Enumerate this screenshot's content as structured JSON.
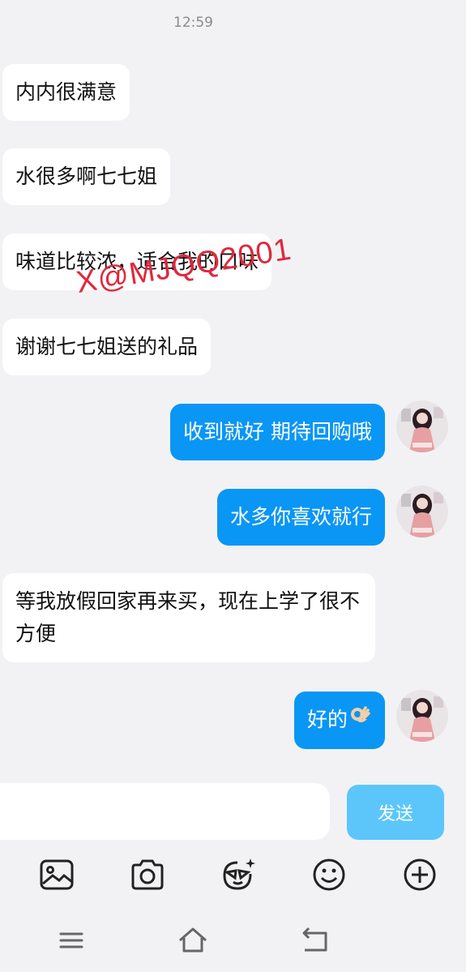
{
  "status": {
    "time": "12:59"
  },
  "messages": [
    {
      "side": "left",
      "text": "内内很满意"
    },
    {
      "side": "left",
      "text": "水很多啊七七姐"
    },
    {
      "side": "left",
      "text": "味道比较浓，适合我的口味"
    },
    {
      "side": "left",
      "text": "谢谢七七姐送的礼品"
    },
    {
      "side": "right",
      "text": "收到就好 期待回购哦"
    },
    {
      "side": "right",
      "text": "水多你喜欢就行"
    },
    {
      "side": "left",
      "text": "等我放假回家再来买，现在上学了很不方便"
    },
    {
      "side": "right",
      "text": "好的",
      "emoji": "ok-hand"
    }
  ],
  "watermark": "X@MJQQ2001",
  "composer": {
    "input_value": "",
    "send_label": "发送",
    "send_color": "#5cc6fb"
  },
  "toolbar": [
    "image-icon",
    "camera-icon",
    "sticker-icon",
    "emoji-icon",
    "add-icon"
  ],
  "navbar": [
    "menu-icon",
    "home-icon",
    "back-icon"
  ],
  "colors": {
    "background": "#f2f2f4",
    "bubble_out": "#0a96f5",
    "bubble_in": "#ffffff",
    "watermark": "#e0283c"
  }
}
